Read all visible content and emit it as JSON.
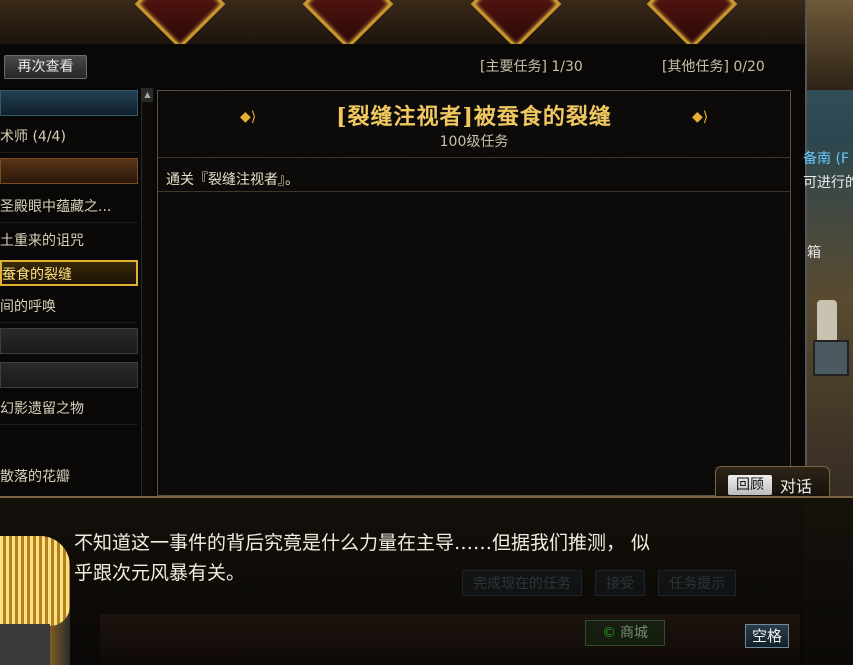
{
  "top": {
    "diamond_count": 4
  },
  "header": {
    "recheck_button": "再次查看",
    "main_quest_counter": "[主要任务] 1/30",
    "other_quest_counter": "[其他任务] 0/20"
  },
  "quest_list": {
    "items": [
      {
        "label": "",
        "kind": "cat-blue"
      },
      {
        "label": "术师 (4/4)",
        "kind": "item"
      },
      {
        "label": "",
        "kind": "cat-brown"
      },
      {
        "label": "圣殿眼中蕴藏之...",
        "kind": "item"
      },
      {
        "label": "土重来的诅咒",
        "kind": "item"
      },
      {
        "label": "蚕食的裂缝",
        "kind": "selected"
      },
      {
        "label": "间的呼唤",
        "kind": "item"
      },
      {
        "label": "",
        "kind": "cat"
      },
      {
        "label": "",
        "kind": "cat"
      },
      {
        "label": "幻影遗留之物",
        "kind": "item"
      },
      {
        "label": "",
        "kind": "item"
      },
      {
        "label": "散落的花瓣",
        "kind": "item"
      }
    ]
  },
  "quest_detail": {
    "title": "[裂缝注视者]被蚕食的裂缝",
    "level_text": "100级任务",
    "objective": "通关『裂缝注视者』。"
  },
  "scene": {
    "npc_text": "备南 (F",
    "npc_text2": "可进行的",
    "box_text": "箱"
  },
  "dialog": {
    "review_button": "回顾",
    "tab_label": "对话",
    "text_line1": "不知道这一事件的背后究竟是什么力量在主导……但据我们推测，  似",
    "text_line2": "乎跟次元风暴有关。",
    "space_button": "空格",
    "ghost_complete": "完成现在的任务",
    "ghost_accept": "接受",
    "ghost_hint": "任务提示",
    "ghost_shop": "商城"
  },
  "colors": {
    "accent_gold": "#f0c860",
    "selected_border": "#e0b030",
    "panel_border": "#5a5040"
  }
}
